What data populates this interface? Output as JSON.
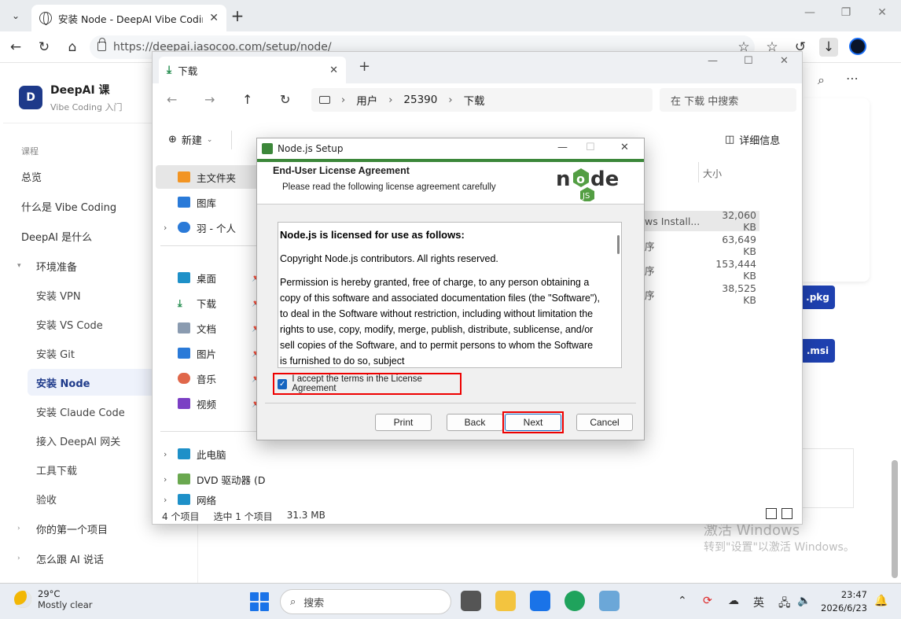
{
  "browser": {
    "tab_title": "安装 Node - DeepAI Vibe Coding 课",
    "url": "https://deepai.iasocoo.com/setup/node/"
  },
  "site": {
    "brand_initial": "D",
    "brand_name": "DeepAI 课",
    "brand_sub": "Vibe Coding 入门",
    "section_label": "课程",
    "items": {
      "overview": "总览",
      "what_vibe": "什么是 Vibe Coding",
      "what_deepai": "DeepAI 是什么",
      "env_prep": "环境准备",
      "vpn": "安装 VPN",
      "vscode": "安装 VS Code",
      "git": "安装 Git",
      "node": "安装 Node",
      "claude": "安装 Claude Code",
      "gateway": "接入 DeepAI 网关",
      "tools": "工具下载",
      "accept": "验收",
      "first_project": "你的第一个项目",
      "talk_ai": "怎么跟 AI 说话"
    },
    "pkg_btn": ".pkg",
    "msi_btn": ".msi",
    "activate_1": "激活 Windows",
    "activate_2": "转到\"设置\"以激活 Windows。"
  },
  "explorer": {
    "tab_title": "下载",
    "breadcrumbs": [
      "用户",
      "25390",
      "下载"
    ],
    "search_placeholder": "在 下载 中搜索",
    "new_label": "新建",
    "details_label": "详细信息",
    "nav": {
      "home": "主文件夹",
      "gallery": "图库",
      "onedrive": "羽 - 个人",
      "desktop": "桌面",
      "downloads": "下载",
      "docs": "文档",
      "pictures": "图片",
      "music": "音乐",
      "videos": "视频",
      "thispc": "此电脑",
      "dvd": "DVD 驱动器 (D",
      "network": "网络"
    },
    "col_size": "大小",
    "files": [
      {
        "name": "ws Install...",
        "size": "32,060 KB"
      },
      {
        "name": "序",
        "size": "63,649 KB"
      },
      {
        "name": "序",
        "size": "153,444 KB"
      },
      {
        "name": "序",
        "size": "38,525 KB"
      }
    ],
    "status": {
      "count": "4 个项目",
      "selected": "选中 1 个项目",
      "size": "31.3 MB"
    }
  },
  "dialog": {
    "title": "Node.js Setup",
    "heading": "End-User License Agreement",
    "subheading": "Please read the following license agreement carefully",
    "license_title": "Node.js is licensed for use as follows:",
    "license_p1": "Copyright Node.js contributors. All rights reserved.",
    "license_p2": "Permission is hereby granted, free of charge, to any person obtaining a copy of this software and associated documentation files (the \"Software\"), to deal in the Software without restriction, including without limitation the rights to use, copy, modify, merge, publish, distribute, sublicense, and/or sell copies of the Software, and to permit persons to whom the Software is furnished to do so, subject",
    "accept_label": "I accept the terms in the License Agreement",
    "accept_checked": true,
    "buttons": {
      "print": "Print",
      "back": "Back",
      "next": "Next",
      "cancel": "Cancel"
    }
  },
  "taskbar": {
    "temp": "29°C",
    "weather": "Mostly clear",
    "search_placeholder": "搜索",
    "ime": "英",
    "time": "23:47",
    "date": "2026/6/23"
  }
}
